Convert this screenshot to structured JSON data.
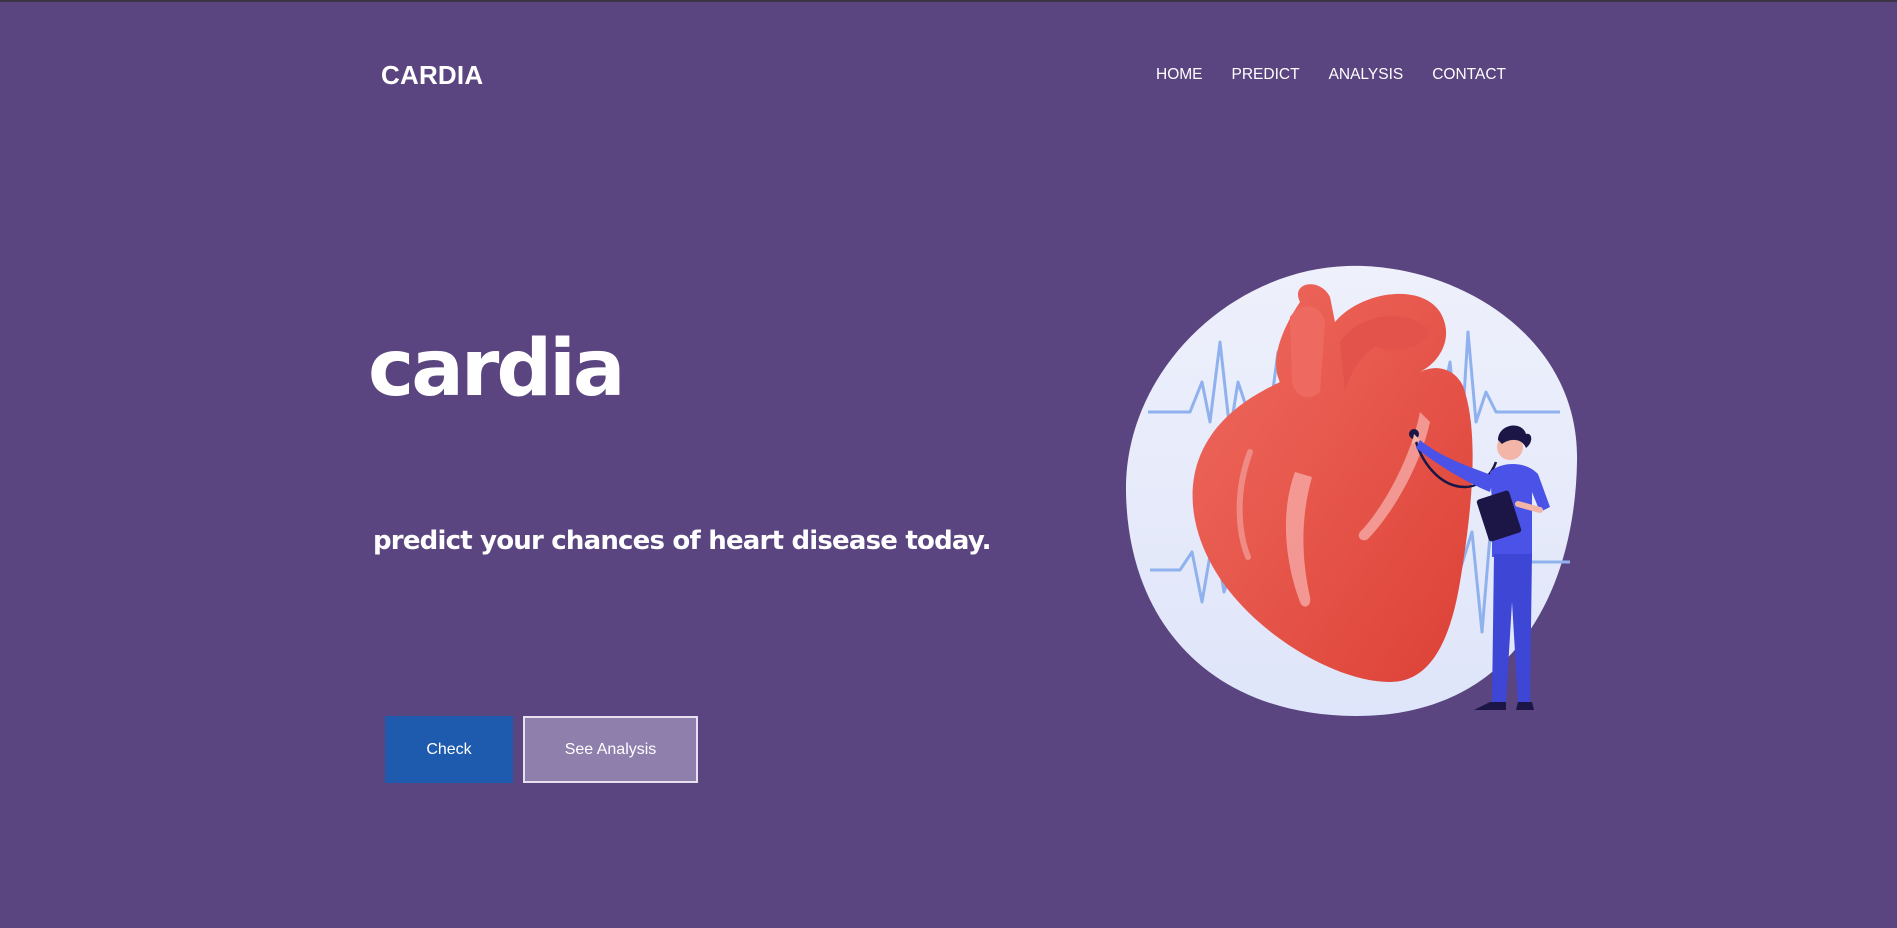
{
  "navbar": {
    "brand": "CARDIA",
    "links": [
      "HOME",
      "PREDICT",
      "ANALYSIS",
      "CONTACT"
    ]
  },
  "hero": {
    "title": "cardia",
    "subtitle": "predict your chances of heart disease today.",
    "buttons": {
      "check": "Check",
      "analysis": "See Analysis"
    },
    "illustration": "heart-doctor-illustration"
  },
  "colors": {
    "background": "#5a4580",
    "check_button": "#1e5aad",
    "analysis_button": "#8f7fad",
    "heart": "#e4534b",
    "doctor": "#4a52e8"
  }
}
